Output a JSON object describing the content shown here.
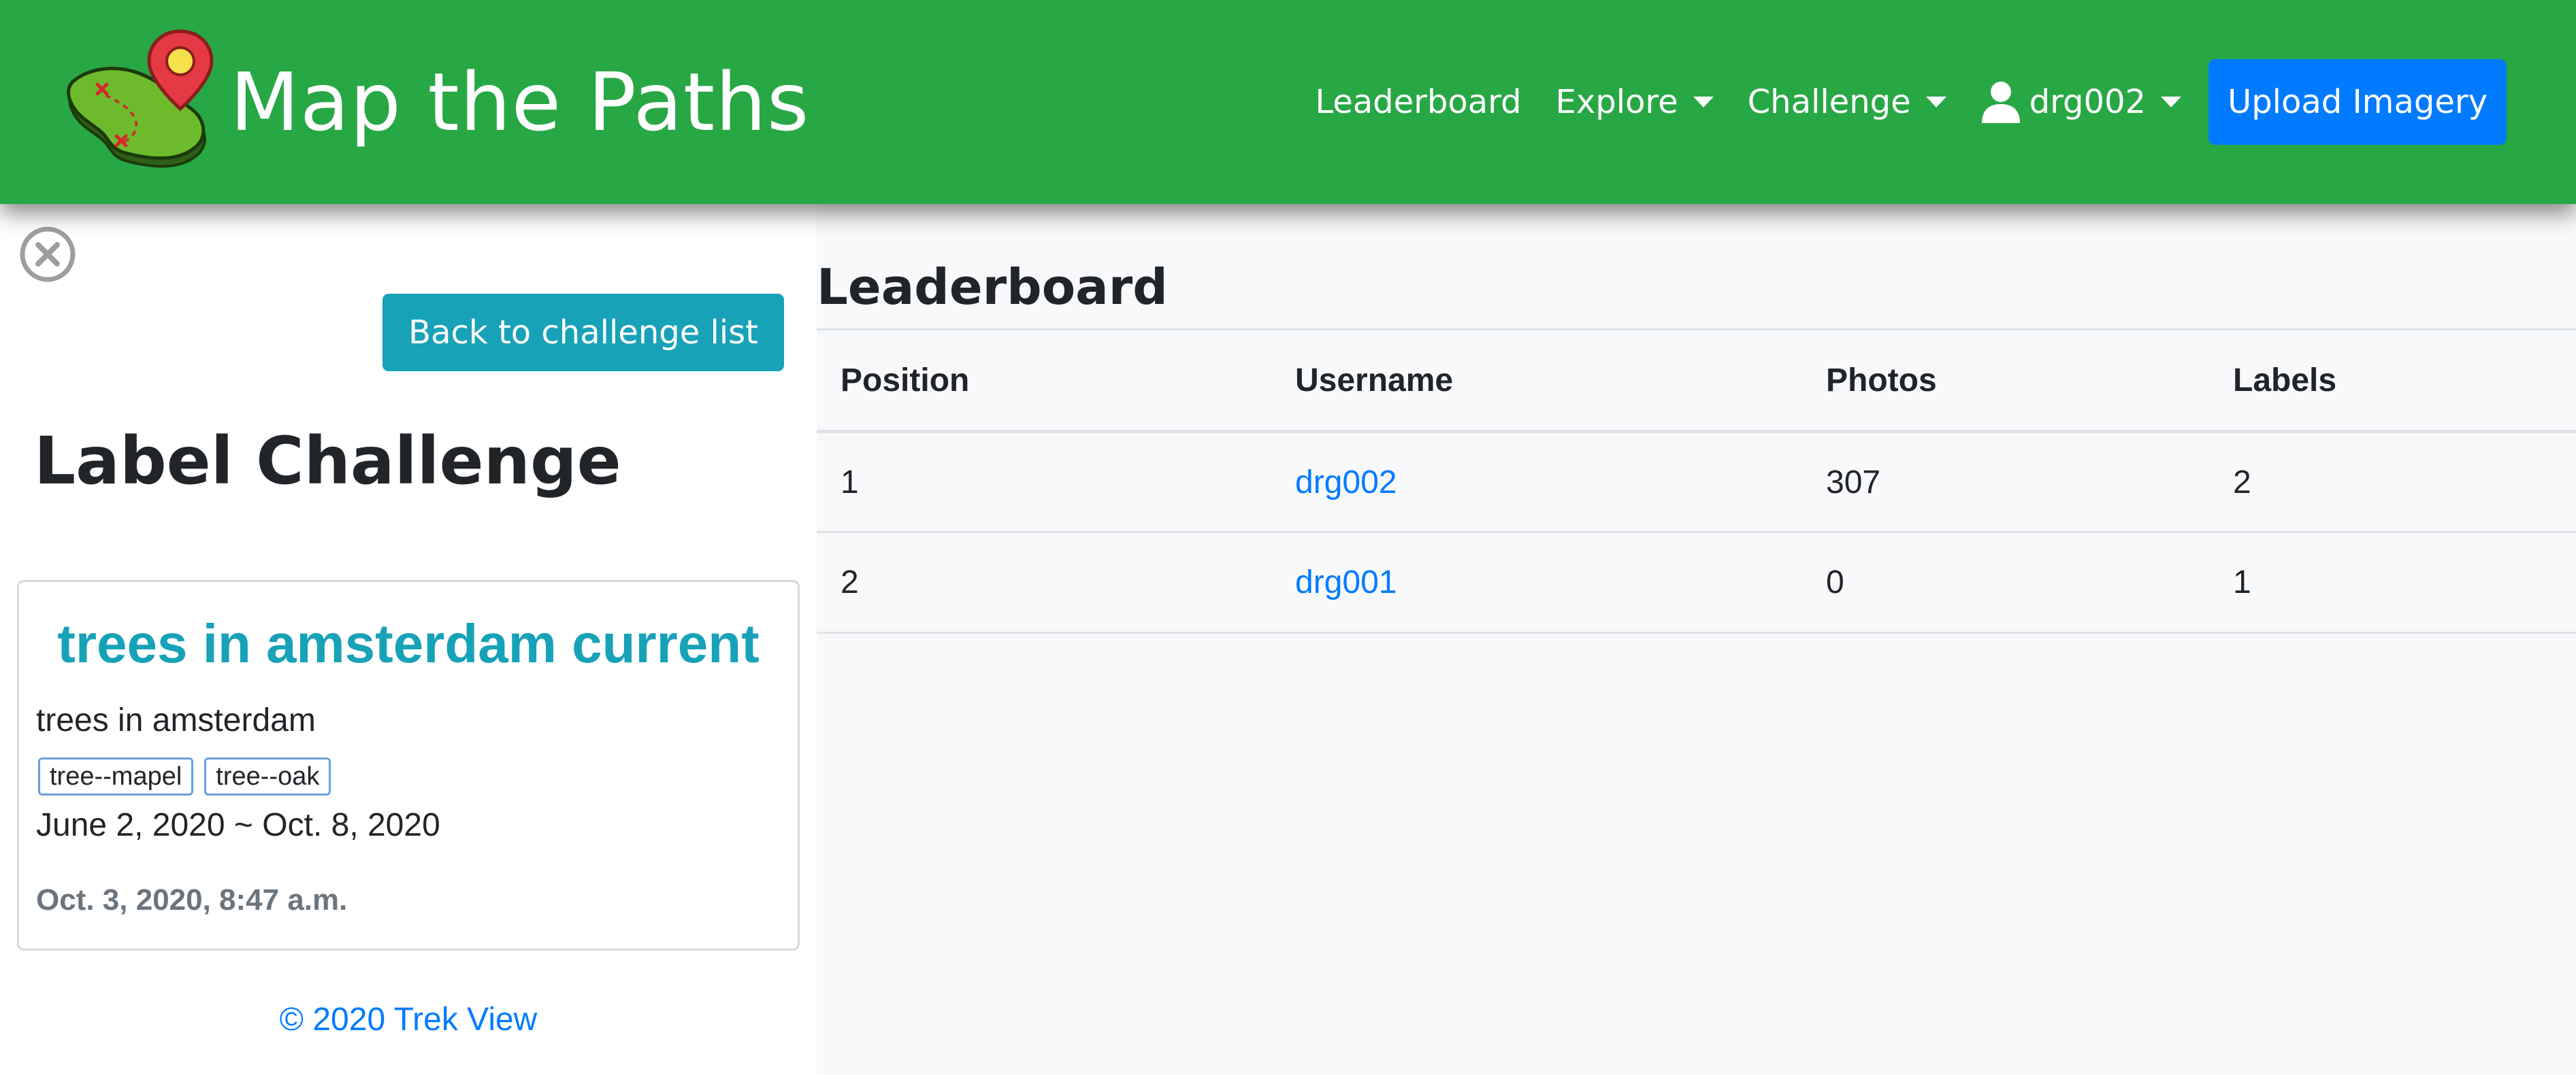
{
  "navbar": {
    "brand": "Map the Paths",
    "links": {
      "leaderboard": "Leaderboard",
      "explore": "Explore",
      "challenge": "Challenge",
      "user": "drg002"
    },
    "upload_label": "Upload Imagery",
    "colors": {
      "background": "#28a745",
      "upload_button": "#007bff"
    }
  },
  "sidebar": {
    "back_label": "Back to challenge list",
    "title": "Label Challenge",
    "card": {
      "title": "trees in amsterdam current",
      "description": "trees in amsterdam",
      "tags": [
        "tree--mapel",
        "tree--oak"
      ],
      "dates": "June 2, 2020 ~ Oct. 8, 2020",
      "created": "Oct. 3, 2020, 8:47 a.m."
    },
    "footer": "© 2020 Trek View"
  },
  "leaderboard": {
    "title": "Leaderboard",
    "columns": [
      "Position",
      "Username",
      "Photos",
      "Labels"
    ],
    "rows": [
      {
        "position": "1",
        "username": "drg002",
        "photos": "307",
        "labels": "2"
      },
      {
        "position": "2",
        "username": "drg001",
        "photos": "0",
        "labels": "1"
      }
    ]
  },
  "icons": [
    "map-logo-icon",
    "user-icon",
    "caret-down-icon",
    "close-circle-icon"
  ]
}
